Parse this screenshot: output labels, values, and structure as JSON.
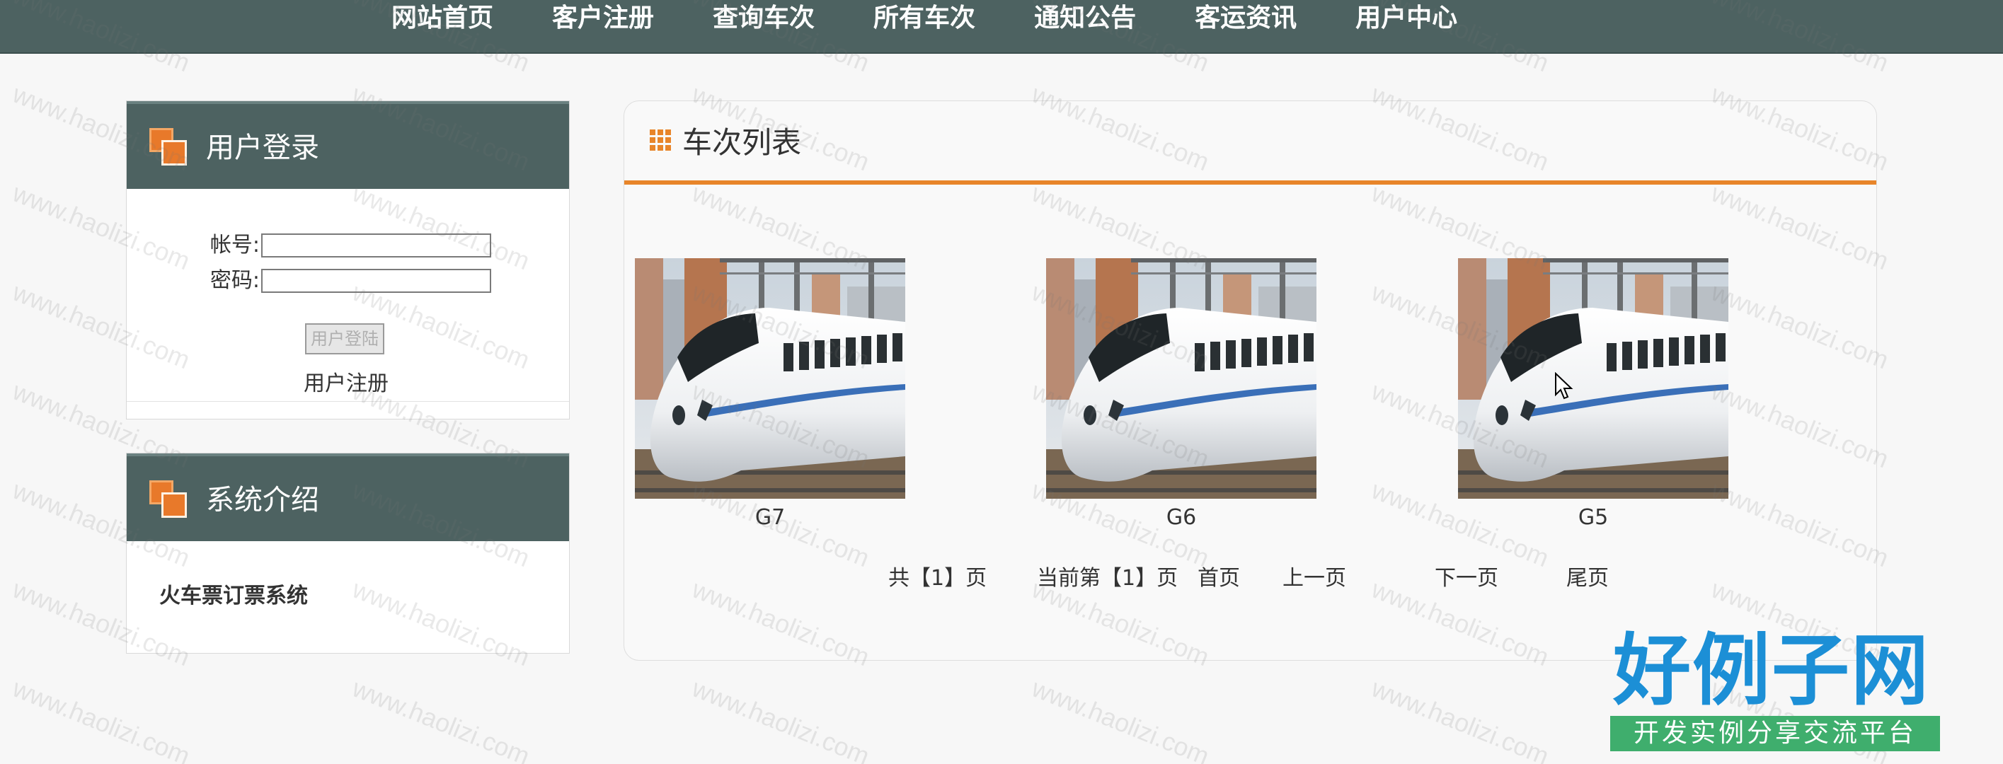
{
  "nav": {
    "items": [
      "网站首页",
      "客户注册",
      "查询车次",
      "所有车次",
      "通知公告",
      "客运资讯",
      "用户中心"
    ]
  },
  "login": {
    "title": "用户登录",
    "account_label": "帐号:",
    "account_value": "",
    "password_label": "密码:",
    "password_value": "",
    "login_button": "用户登陆",
    "register_link": "用户注册"
  },
  "intro": {
    "title": "系统介绍",
    "text": "火车票订票系统"
  },
  "trains": {
    "title": "车次列表",
    "items": [
      {
        "name": "G7"
      },
      {
        "name": "G6"
      },
      {
        "name": "G5"
      }
    ]
  },
  "pager": {
    "total": "共【1】页",
    "current": "当前第【1】页",
    "first": "首页",
    "prev": "上一页",
    "next": "下一页",
    "last": "尾页"
  },
  "logo": {
    "name": "好例子网",
    "slogan": "开发实例分享交流平台"
  },
  "watermark": {
    "text": "www.haolizi.com"
  },
  "colors": {
    "nav_bg": "#4d6261",
    "accent": "#e8852a",
    "logo_blue": "#1c8fd6",
    "logo_green": "#3fae6d"
  },
  "icons": {
    "sidebar_head": "stacked-squares-icon",
    "panel_head": "grid-icon",
    "pointer": "mouse-cursor-icon"
  }
}
